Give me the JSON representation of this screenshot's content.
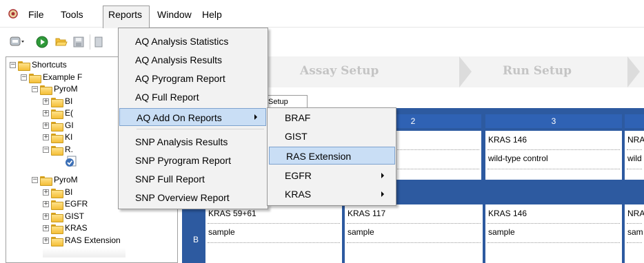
{
  "menubar": {
    "items": [
      "File",
      "Tools",
      "Reports",
      "Window",
      "Help"
    ]
  },
  "tree": {
    "items": [
      "Shortcuts",
      "Example F",
      "PyroM",
      "BI",
      "E(",
      "GI",
      "KI",
      "R.",
      "PyroM",
      "BI",
      "EGFR",
      "GIST",
      "KRAS",
      "RAS Extension"
    ]
  },
  "steps": {
    "assay": "Assay Setup",
    "run": "Run Setup"
  },
  "tab": {
    "label": "is Setup"
  },
  "plate": {
    "columns": [
      "2",
      "3"
    ],
    "rows": [
      {
        "id": "A",
        "cells": [
          {
            "assay": "",
            "sample": "ontrol"
          },
          {
            "assay": "KRAS 146",
            "sample": "wild-type control"
          },
          {
            "assay": "NRA",
            "sample": "wild"
          }
        ]
      },
      {
        "id": "B",
        "cells": [
          {
            "assay": "KRAS 59+61",
            "sample": "sample"
          },
          {
            "assay": "KRAS 117",
            "sample": "sample"
          },
          {
            "assay": "KRAS 146",
            "sample": "sample"
          },
          {
            "assay": "NRA",
            "sample": "sam"
          }
        ]
      }
    ]
  },
  "reports_menu": {
    "items": [
      "AQ Analysis Statistics",
      "AQ Analysis Results",
      "AQ Pyrogram Report",
      "AQ Full Report",
      "AQ Add On Reports",
      "SNP Analysis Results",
      "SNP Pyrogram Report",
      "SNP Full Report",
      "SNP Overview Report"
    ],
    "highlighted": "AQ Add On Reports"
  },
  "addon_menu": {
    "items": [
      "BRAF",
      "GIST",
      "RAS Extension",
      "EGFR",
      "KRAS"
    ],
    "highlighted": "RAS Extension"
  },
  "colors": {
    "plate_border": "#2d5aa0",
    "column_header": "#2f62b4",
    "menu_highlight": "#c9def5",
    "folder": "#f4be37"
  }
}
